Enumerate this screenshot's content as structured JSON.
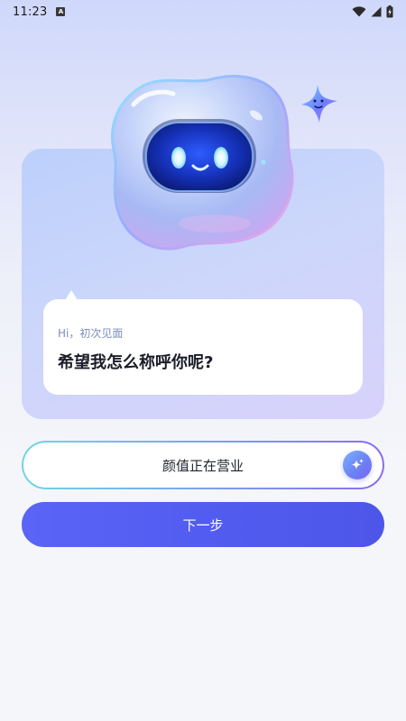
{
  "status_bar": {
    "time": "11:23",
    "notification_icon": "A",
    "icons": [
      "wifi-icon",
      "signal-icon",
      "battery-icon"
    ]
  },
  "bubble": {
    "greeting": "Hi，初次见面",
    "question": "希望我怎么称呼你呢?"
  },
  "name_field": {
    "value": "颜值正在营业",
    "magic_icon": "sparkle-icon"
  },
  "next_button": {
    "label": "下一步"
  },
  "colors": {
    "primary": "#525cf0",
    "greeting_text": "#7d8db8",
    "card_bg": "#ccd6fb"
  }
}
